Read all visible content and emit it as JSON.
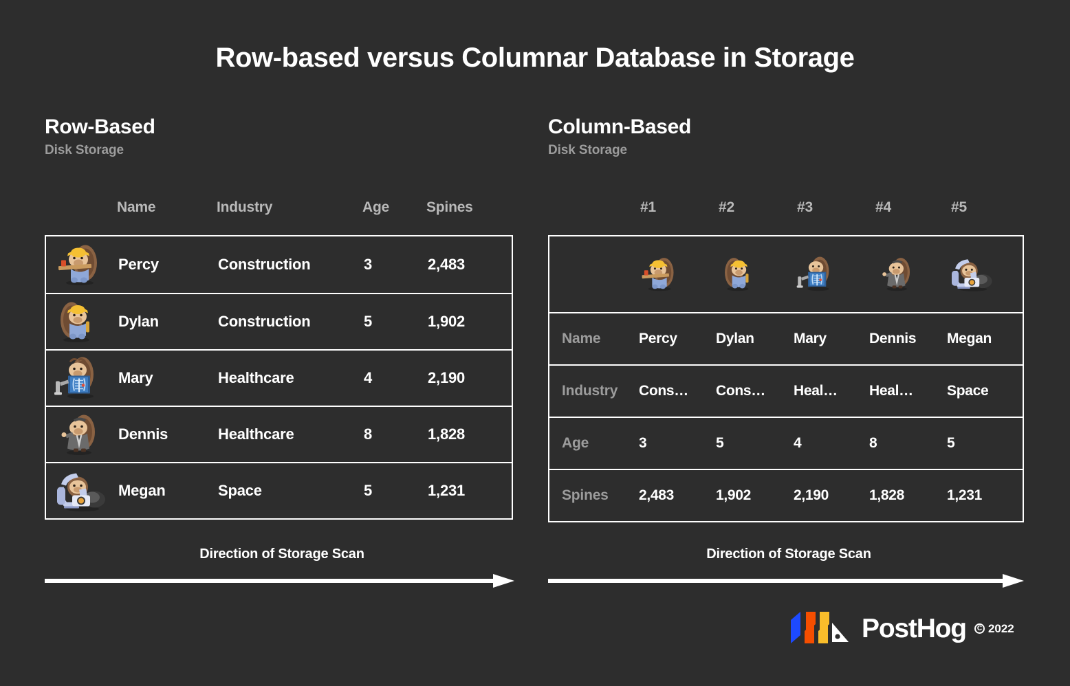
{
  "title": "Row-based versus Columnar Database in Storage",
  "theme": {
    "background": "#2d2d2d",
    "border": "#ffffff",
    "text": "#ffffff",
    "muted": "#9c9c9c",
    "header_muted": "#b9b9b9",
    "logo_blue": "#1d4aff",
    "logo_red": "#f54e00",
    "logo_yellow": "#f9bd2b"
  },
  "left": {
    "heading": "Row-Based",
    "subheading": "Disk Storage",
    "columns": [
      "Name",
      "Industry",
      "Age",
      "Spines"
    ],
    "rows": [
      {
        "avatar": "hedgehog-construction-plank-icon",
        "name": "Percy",
        "industry": "Construction",
        "age": "3",
        "spines": "2,483"
      },
      {
        "avatar": "hedgehog-construction-hardhat-icon",
        "name": "Dylan",
        "industry": "Construction",
        "age": "5",
        "spines": "1,902"
      },
      {
        "avatar": "hedgehog-healthcare-xray-icon",
        "name": "Mary",
        "industry": "Healthcare",
        "age": "4",
        "spines": "2,190"
      },
      {
        "avatar": "hedgehog-detective-icon",
        "name": "Dennis",
        "industry": "Healthcare",
        "age": "8",
        "spines": "1,828"
      },
      {
        "avatar": "hedgehog-astronaut-icon",
        "name": "Megan",
        "industry": "Space",
        "age": "5",
        "spines": "1,231"
      }
    ],
    "scan_label": "Direction of Storage Scan"
  },
  "right": {
    "heading": "Column-Based",
    "subheading": "Disk Storage",
    "columns": [
      "#1",
      "#2",
      "#3",
      "#4",
      "#5"
    ],
    "avatars": [
      "hedgehog-construction-plank-icon",
      "hedgehog-construction-hardhat-icon",
      "hedgehog-healthcare-xray-icon",
      "hedgehog-detective-icon",
      "hedgehog-astronaut-icon"
    ],
    "rows": [
      {
        "label": "Name",
        "values": [
          "Percy",
          "Dylan",
          "Mary",
          "Dennis",
          "Megan"
        ]
      },
      {
        "label": "Industry",
        "values": [
          "Cons…",
          "Cons…",
          "Heal…",
          "Heal…",
          "Space"
        ]
      },
      {
        "label": "Age",
        "values": [
          "3",
          "5",
          "4",
          "8",
          "5"
        ]
      },
      {
        "label": "Spines",
        "values": [
          "2,483",
          "1,902",
          "2,190",
          "1,828",
          "1,231"
        ]
      }
    ],
    "scan_label": "Direction of Storage Scan"
  },
  "logo": {
    "wordmark": "PostHog",
    "copyright_symbol": "C",
    "year": "2022"
  }
}
